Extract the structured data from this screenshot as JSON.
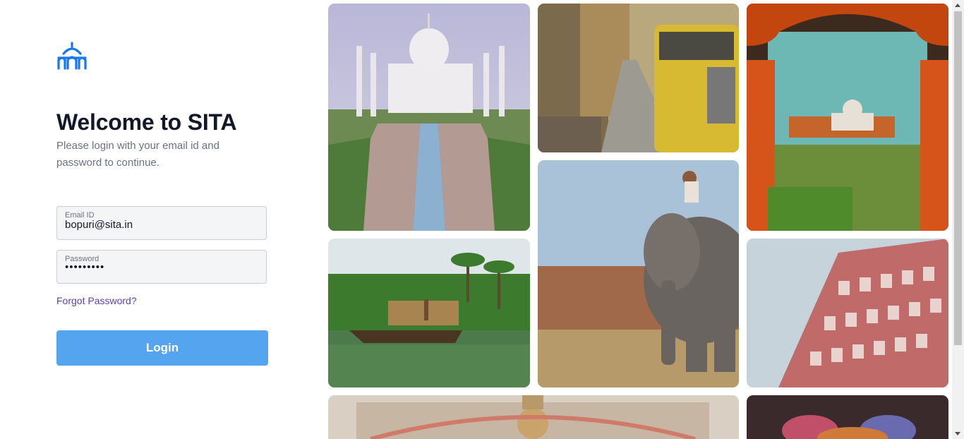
{
  "brand": {
    "logo_icon": "palace-dome-logo-icon",
    "accent": "#1877f2"
  },
  "login": {
    "title": "Welcome to SITA",
    "subtitle": "Please login with your email id and password to continue.",
    "email": {
      "label": "Email ID",
      "value": "bopuri@sita.in"
    },
    "password": {
      "label": "Password",
      "value": "•••••••••"
    },
    "forgot_label": "Forgot Password?",
    "login_label": "Login",
    "button_color": "#55a4ef"
  },
  "gallery": {
    "images": [
      "taj-mahal-image",
      "street-rickshaw-image",
      "taj-through-arch-image",
      "kerala-houseboat-image",
      "elephant-rider-image",
      "hawa-mahal-image",
      "palace-ceiling-image",
      "holi-colors-image"
    ]
  }
}
